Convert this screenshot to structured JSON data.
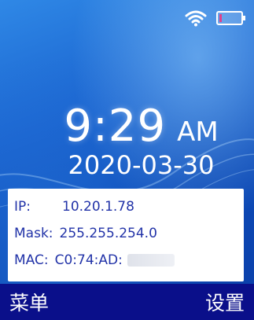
{
  "status_bar": {
    "wifi_icon": "wifi-icon",
    "battery_icon": "battery-icon",
    "battery_level": 0.1
  },
  "clock": {
    "time": "9:29",
    "ampm": "AM",
    "date": "2020-03-30"
  },
  "network_info": {
    "ip_label": "IP:",
    "ip_value": "10.20.1.78",
    "mask_label": "Mask:",
    "mask_value": "255.255.254.0",
    "mac_label": "MAC:",
    "mac_value": "C0:74:AD:"
  },
  "softkeys": {
    "left_label": "菜单",
    "right_label": "设置"
  },
  "colors": {
    "softkey_bar": "#0a0f8a",
    "info_text": "#2233a8",
    "battery_low": "#e0408c"
  }
}
